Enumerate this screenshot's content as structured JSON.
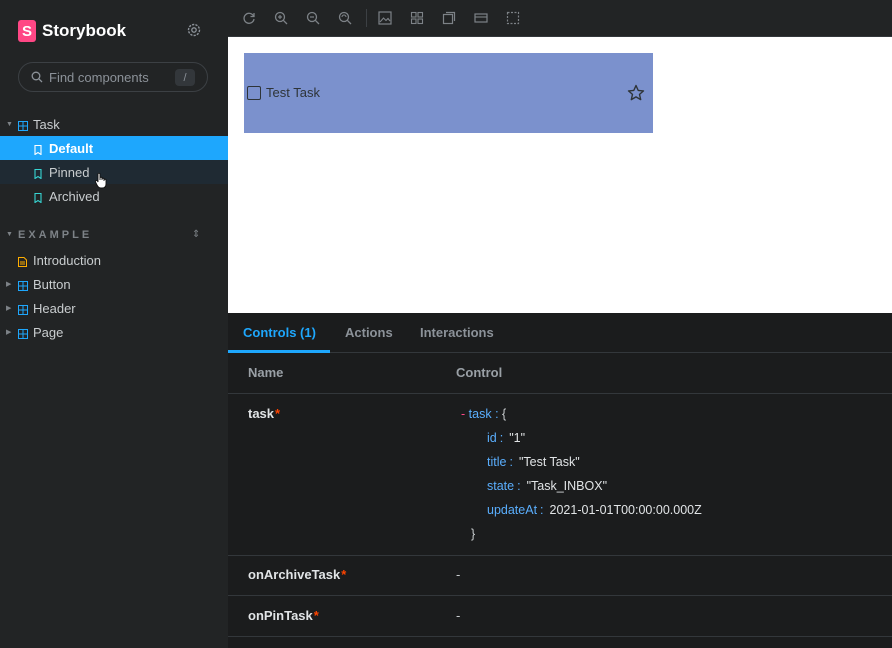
{
  "brand": {
    "name": "Storybook",
    "logo_letter": "S",
    "accent": "#ff4785"
  },
  "search": {
    "placeholder": "Find components",
    "shortcut": "/"
  },
  "sidebar": {
    "tree": [
      {
        "label": "Task",
        "type": "component",
        "expanded": true
      },
      {
        "label": "Default",
        "type": "story",
        "selected": true
      },
      {
        "label": "Pinned",
        "type": "story",
        "hovered": true
      },
      {
        "label": "Archived",
        "type": "story"
      }
    ],
    "section_title": "EXAMPLE",
    "example_items": [
      {
        "label": "Introduction",
        "type": "docs"
      },
      {
        "label": "Button",
        "type": "component"
      },
      {
        "label": "Header",
        "type": "component"
      },
      {
        "label": "Page",
        "type": "component"
      }
    ]
  },
  "toolbar": {
    "icons": [
      "reload-icon",
      "zoom-in-icon",
      "zoom-out-icon",
      "zoom-reset-icon",
      "background-icon",
      "grid-icon",
      "viewport-icon",
      "measure-icon",
      "outline-icon"
    ]
  },
  "preview": {
    "task_title": "Test Task",
    "card_color": "#7b91cd"
  },
  "addons": {
    "tabs": [
      "Controls (1)",
      "Actions",
      "Interactions"
    ],
    "active_tab": "Controls (1)",
    "headers": {
      "name": "Name",
      "control": "Control"
    },
    "args": [
      {
        "name": "task",
        "required": "*"
      },
      {
        "name": "onArchiveTask",
        "required": "*",
        "value": "-"
      },
      {
        "name": "onPinTask",
        "required": "*",
        "value": "-"
      }
    ],
    "task_object": {
      "toggle": "-",
      "key": "task",
      "colon": ":",
      "open": "{",
      "close": "}",
      "fields": [
        {
          "key": "id",
          "value": "\"1\""
        },
        {
          "key": "title",
          "value": "\"Test Task\""
        },
        {
          "key": "state",
          "value": "\"Task_INBOX\""
        },
        {
          "key": "updateAt",
          "value": "2021-01-01T00:00:00.000Z"
        }
      ]
    }
  }
}
